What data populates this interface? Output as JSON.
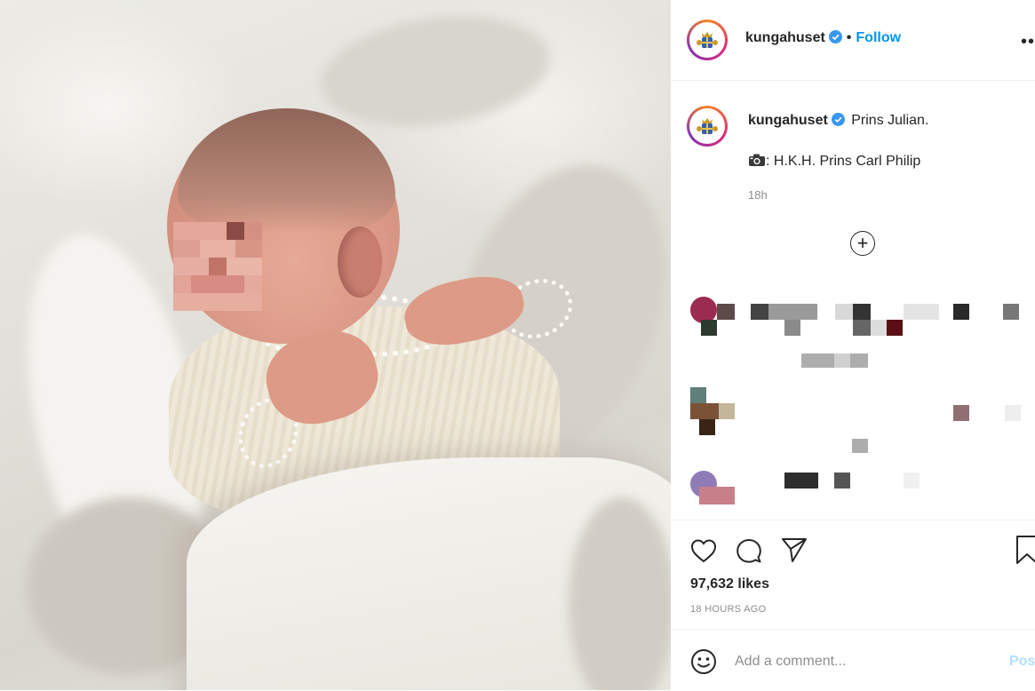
{
  "post": {
    "username": "kungahuset",
    "verified": true,
    "follow_label": "Follow",
    "separator": "•",
    "more_label": "••",
    "photo_alt": "Prins Julian photo"
  },
  "caption": {
    "username": "kungahuset",
    "text": "Prins Julian.",
    "camera_icon": "camera-icon",
    "credit": ": H.K.H. Prins Carl Philip",
    "time": "18h"
  },
  "comments": {
    "load_more_icon": "plus-circle-icon"
  },
  "actions": {
    "like_icon": "heart-icon",
    "comment_icon": "speech-bubble-icon",
    "share_icon": "paper-plane-icon",
    "save_icon": "bookmark-icon",
    "likes": "97,632 likes",
    "posted": "18 HOURS AGO"
  },
  "comment_bar": {
    "emoji_icon": "smiley-icon",
    "placeholder": "Add a comment...",
    "post_label": "Pos"
  },
  "colors": {
    "accent": "#0095f6",
    "post_button_disabled": "#b2dffc",
    "muted_text": "#8e8e8e"
  }
}
